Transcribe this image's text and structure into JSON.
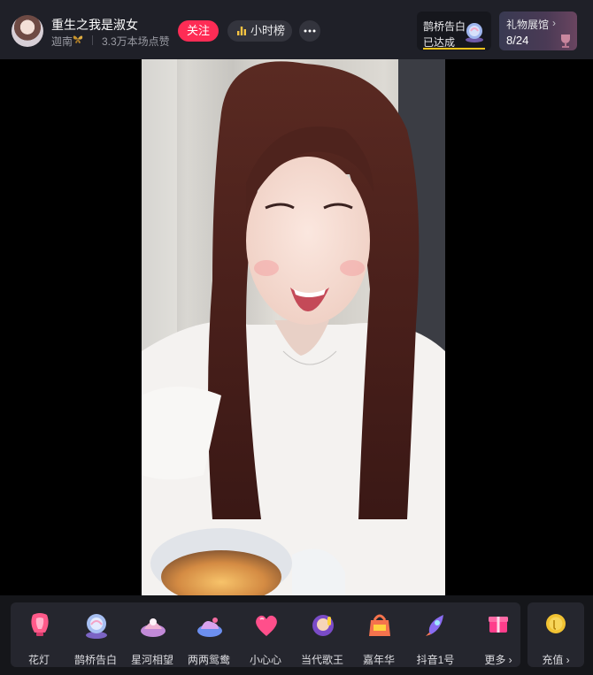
{
  "header": {
    "streamer_name": "重生之我是淑女",
    "location": "迦南",
    "likes": "3.3万本场点赞",
    "follow_label": "关注",
    "rank_label": "小时榜",
    "more_icon": "ellipsis-icon",
    "task_card": {
      "title": "鹊桥告白",
      "status": "已达成",
      "progress": 1.0,
      "icon": "gift-icon"
    },
    "gift_gallery": {
      "title": "礼物展馆",
      "chevron": "›",
      "count": "8/24",
      "icon": "trophy-icon"
    }
  },
  "gifts": [
    {
      "label": "花灯",
      "icon": "lantern-icon"
    },
    {
      "label": "鹊桥告白",
      "icon": "snow-globe-icon"
    },
    {
      "label": "星河相望",
      "icon": "galaxy-icon"
    },
    {
      "label": "两两鸳鸯",
      "icon": "mandarin-duck-icon"
    },
    {
      "label": "小心心",
      "icon": "heart-icon"
    },
    {
      "label": "当代歌王",
      "icon": "singer-icon"
    },
    {
      "label": "嘉年华",
      "icon": "carnival-icon"
    },
    {
      "label": "抖音1号",
      "icon": "rocket-icon"
    }
  ],
  "more_gifts_label": "更多 ›",
  "recharge_label": "充值 ›",
  "colors": {
    "follow": "#fe2c55",
    "progress": "#f4c21b",
    "background": "#1f2028"
  }
}
